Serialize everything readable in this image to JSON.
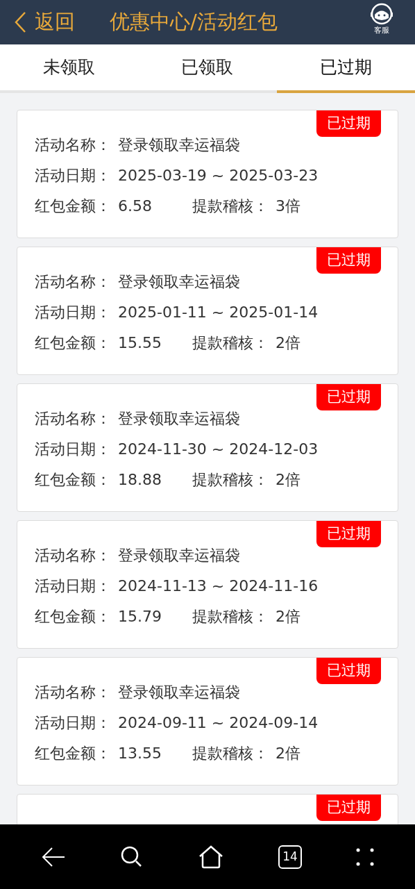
{
  "header": {
    "back": "返回",
    "title": "优惠中心/活动红包",
    "service": "客服"
  },
  "tabs": [
    {
      "label": "未领取",
      "selected": false
    },
    {
      "label": "已领取",
      "selected": false
    },
    {
      "label": "已过期",
      "selected": true
    }
  ],
  "cards": [
    {
      "badge": "已过期",
      "name_label": "活动名称：",
      "name": "登录领取幸运福袋",
      "date_label": "活动日期：",
      "date": "2025-03-19 ~ 2025-03-23",
      "amount_label": "红包金额：",
      "amount": "6.58",
      "audit_label": "提款稽核：",
      "audit": "3倍"
    },
    {
      "badge": "已过期",
      "name_label": "活动名称：",
      "name": "登录领取幸运福袋",
      "date_label": "活动日期：",
      "date": "2025-01-11 ~ 2025-01-14",
      "amount_label": "红包金额：",
      "amount": "15.55",
      "audit_label": "提款稽核：",
      "audit": "2倍"
    },
    {
      "badge": "已过期",
      "name_label": "活动名称：",
      "name": "登录领取幸运福袋",
      "date_label": "活动日期：",
      "date": "2024-11-30 ~ 2024-12-03",
      "amount_label": "红包金额：",
      "amount": "18.88",
      "audit_label": "提款稽核：",
      "audit": "2倍"
    },
    {
      "badge": "已过期",
      "name_label": "活动名称：",
      "name": "登录领取幸运福袋",
      "date_label": "活动日期：",
      "date": "2024-11-13 ~ 2024-11-16",
      "amount_label": "红包金额：",
      "amount": "15.79",
      "audit_label": "提款稽核：",
      "audit": "2倍"
    },
    {
      "badge": "已过期",
      "name_label": "活动名称：",
      "name": "登录领取幸运福袋",
      "date_label": "活动日期：",
      "date": "2024-09-11 ~ 2024-09-14",
      "amount_label": "红包金额：",
      "amount": "13.55",
      "audit_label": "提款稽核：",
      "audit": "2倍"
    },
    {
      "badge": "已过期"
    }
  ],
  "nav_bar": {
    "tab_count": "14"
  }
}
